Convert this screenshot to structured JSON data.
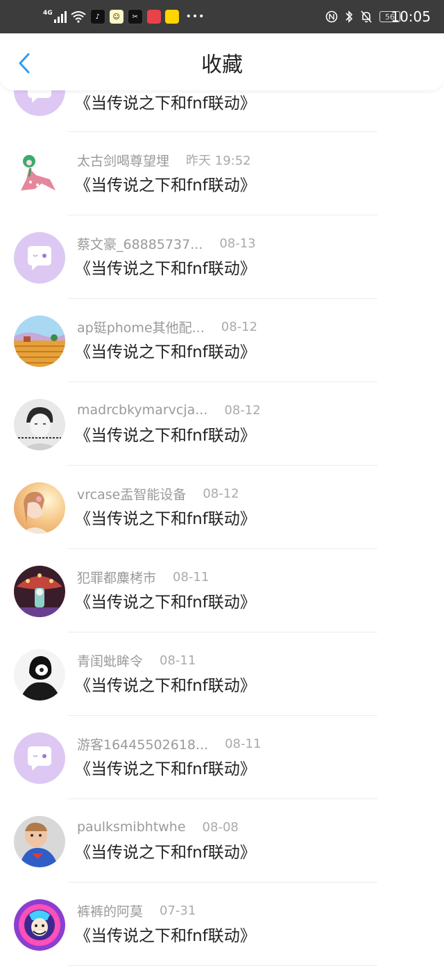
{
  "status_bar": {
    "network": "4G",
    "battery": "56",
    "time": "10:05",
    "icons": [
      "signal-icon",
      "wifi-icon",
      "tiktok-icon",
      "app-icon",
      "capcut-icon",
      "app-icon",
      "app-icon",
      "nfc-icon",
      "bluetooth-icon",
      "mute-bell-icon",
      "battery-icon"
    ]
  },
  "header": {
    "title": "收藏",
    "back_icon": "chevron-left-icon",
    "accent": "#2d9df2"
  },
  "items": [
    {
      "name": "",
      "date": "",
      "content": "《当传说之下和fnf联动》",
      "avatar": "default"
    },
    {
      "name": "太古剑喝尊望埋",
      "date": "昨天 19:52",
      "content": "《当传说之下和fnf联动》",
      "avatar": "flower"
    },
    {
      "name": "蔡文豪_68885737...",
      "date": "08-13",
      "content": "《当传说之下和fnf联动》",
      "avatar": "default"
    },
    {
      "name": "ap铤phome其他配...",
      "date": "08-12",
      "content": "《当传说之下和fnf联动》",
      "avatar": "landscape"
    },
    {
      "name": "madrcbkymarvcja...",
      "date": "08-12",
      "content": "《当传说之下和fnf联动》",
      "avatar": "bw"
    },
    {
      "name": "vrcase盂智能设备",
      "date": "08-12",
      "content": "《当传说之下和fnf联动》",
      "avatar": "girl"
    },
    {
      "name": "犯罪都麋栲市",
      "date": "08-11",
      "content": "《当传说之下和fnf联动》",
      "avatar": "mushroom"
    },
    {
      "name": "青闺蚍眸令",
      "date": "08-11",
      "content": "《当传说之下和fnf联动》",
      "avatar": "dark"
    },
    {
      "name": "游客16445502618...",
      "date": "08-11",
      "content": "《当传说之下和fnf联动》",
      "avatar": "default"
    },
    {
      "name": "paulksmibhtwhe",
      "date": "08-08",
      "content": "《当传说之下和fnf联动》",
      "avatar": "baby"
    },
    {
      "name": "裤裤的阿莫",
      "date": "07-31",
      "content": "《当传说之下和fnf联动》",
      "avatar": "fnf"
    }
  ]
}
